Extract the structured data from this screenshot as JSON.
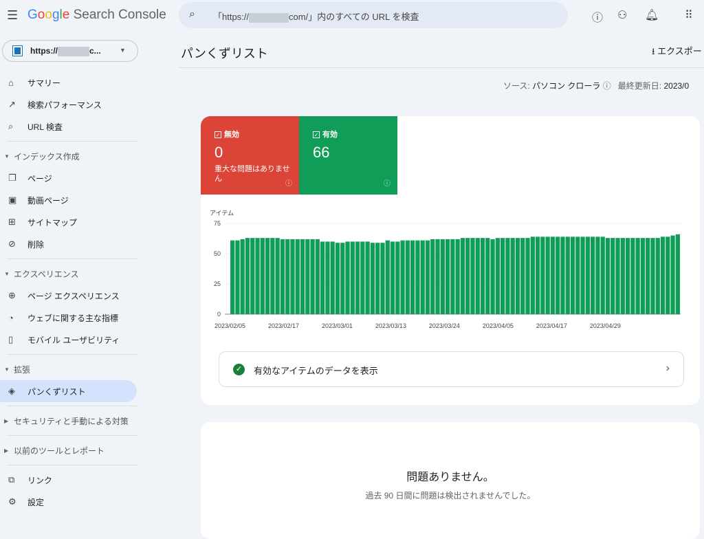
{
  "header": {
    "app_title": "Google Search Console",
    "search_placeholder_prefix": "「https://",
    "search_placeholder_suffix": "com/」内のすべての URL を検査"
  },
  "property": {
    "label_prefix": "https://",
    "label_suffix": "c..."
  },
  "sidebar": {
    "items": [
      {
        "label": "サマリー",
        "icon": "home-icon",
        "glyph": "⌂"
      },
      {
        "label": "検索パフォーマンス",
        "icon": "trending-up-icon",
        "glyph": "↗"
      },
      {
        "label": "URL 検査",
        "icon": "search-icon",
        "glyph": "⌕"
      }
    ],
    "index_section": "インデックス作成",
    "index_items": [
      {
        "label": "ページ",
        "glyph": "❐"
      },
      {
        "label": "動画ページ",
        "glyph": "▣"
      },
      {
        "label": "サイトマップ",
        "glyph": "⊞"
      },
      {
        "label": "削除",
        "glyph": "⊘"
      }
    ],
    "experience_section": "エクスペリエンス",
    "experience_items": [
      {
        "label": "ページ エクスペリエンス",
        "glyph": "⊕"
      },
      {
        "label": "ウェブに関する主な指標",
        "glyph": "◔"
      },
      {
        "label": "モバイル ユーザビリティ",
        "glyph": "▯"
      }
    ],
    "enhancements_section": "拡張",
    "enhancements_items": [
      {
        "label": "パンくずリスト",
        "glyph": "◈"
      }
    ],
    "security_section": "セキュリティと手動による対策",
    "legacy_section": "以前のツールとレポート",
    "bottom_items": [
      {
        "label": "リンク",
        "glyph": "⧉"
      },
      {
        "label": "設定",
        "glyph": "⚙"
      }
    ]
  },
  "page": {
    "title": "パンくずリスト",
    "export_label": "エクスポート",
    "source_label": "ソース:",
    "source_value": "パソコン クローラ",
    "updated_label": "最終更新日:",
    "updated_value": "2023/0"
  },
  "tiles": {
    "invalid": {
      "label": "無効",
      "value": "0",
      "sub": "重大な問題はありません",
      "color": "#d93025"
    },
    "valid": {
      "label": "有効",
      "value": "66",
      "color": "#0f9d58"
    }
  },
  "chart_data": {
    "type": "bar",
    "ylabel": "アイテム",
    "ylim": [
      0,
      75
    ],
    "yticks": [
      "0",
      "25",
      "50",
      "75"
    ],
    "xticks": [
      "2023/02/05",
      "2023/02/17",
      "2023/03/01",
      "2023/03/13",
      "2023/03/24",
      "2023/04/05",
      "2023/04/17",
      "2023/04/29"
    ],
    "color": "#0f9d58",
    "values": [
      61,
      61,
      62,
      63,
      63,
      63,
      63,
      63,
      63,
      63,
      62,
      62,
      62,
      62,
      62,
      62,
      62,
      62,
      60,
      60,
      60,
      59,
      59,
      60,
      60,
      60,
      60,
      60,
      59,
      59,
      59,
      61,
      60,
      60,
      61,
      61,
      61,
      61,
      61,
      61,
      62,
      62,
      62,
      62,
      62,
      62,
      63,
      63,
      63,
      63,
      63,
      63,
      62,
      63,
      63,
      63,
      63,
      63,
      63,
      63,
      64,
      64,
      64,
      64,
      64,
      64,
      64,
      64,
      64,
      64,
      64,
      64,
      64,
      64,
      64,
      63,
      63,
      63,
      63,
      63,
      63,
      63,
      63,
      63,
      63,
      63,
      64,
      64,
      65,
      66
    ]
  },
  "valid_items_link": "有効なアイテムのデータを表示",
  "issues": {
    "title": "問題ありません。",
    "subtitle": "過去 90 日間に問題は検出されませんでした。"
  }
}
